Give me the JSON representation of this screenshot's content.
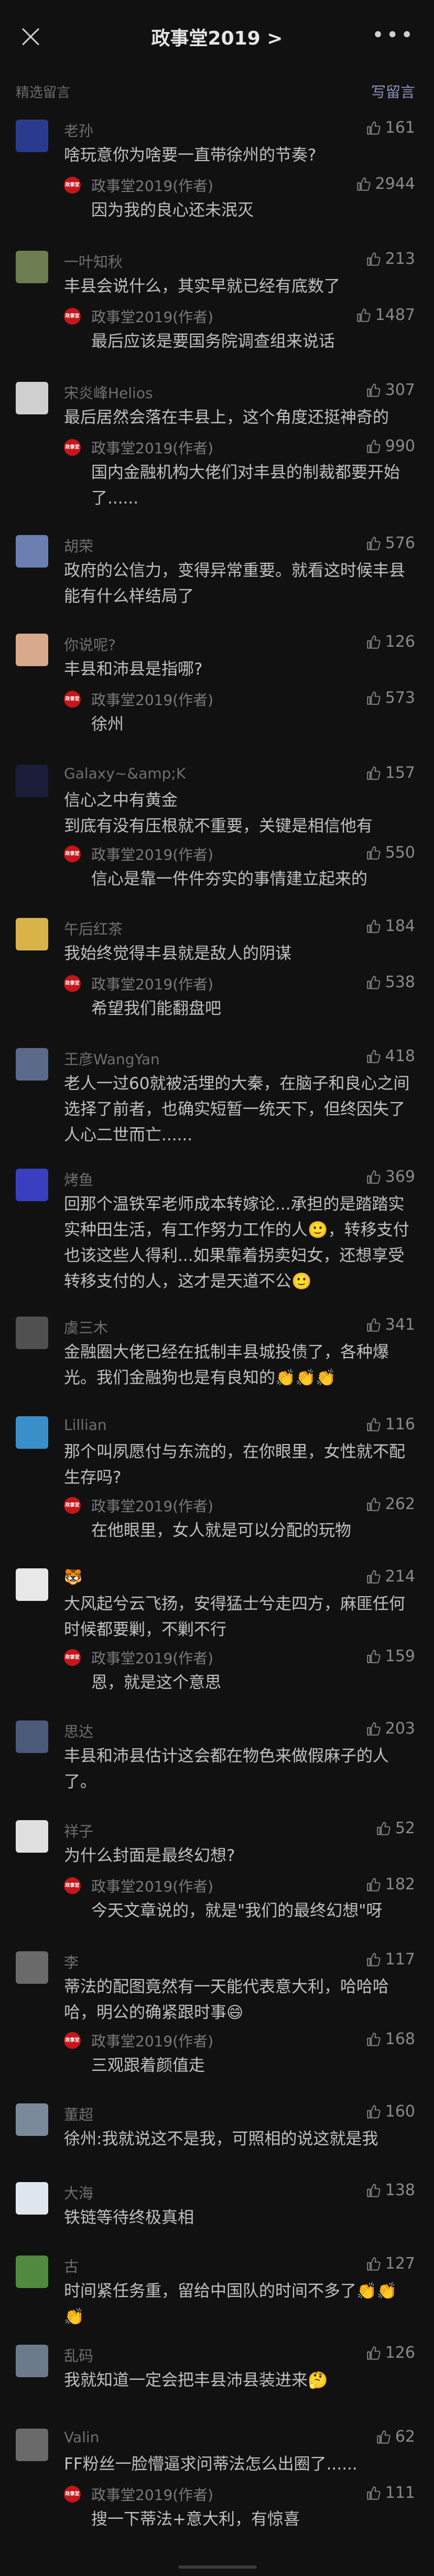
{
  "nav": {
    "title": "政事堂2019 >",
    "more": "•••"
  },
  "section": {
    "label": "精选留言",
    "write": "写留言"
  },
  "colors": {
    "bg": "#111111",
    "text": "#c0c0c0",
    "meta": "#6f6f6f",
    "link": "#8a93b8",
    "brand": "#c5161c"
  },
  "reply_author": "政事堂2019(作者)",
  "avatar_text": "政事堂",
  "comments": [
    {
      "user": "老孙",
      "likes": "161",
      "text": "啥玩意你为啥要一直带徐州的节奏?",
      "reply_likes": "2944",
      "reply": "因为我的良心还未泯灭",
      "avatar": "#2a3b8f"
    },
    {
      "user": "一叶知秋",
      "likes": "213",
      "text": "丰县会说什么，其实早就已经有底数了",
      "reply_likes": "1487",
      "reply": "最后应该是要国务院调查组来说话",
      "avatar": "#6d7d4f"
    },
    {
      "user": "宋炎峰Helios",
      "likes": "307",
      "text": "最后居然会落在丰县上，这个角度还挺神奇的",
      "reply_likes": "990",
      "reply": "国内金融机构大佬们对丰县的制裁都要开始了......",
      "avatar": "#d0d0d0"
    },
    {
      "user": "胡荣",
      "likes": "576",
      "text": "政府的公信力，变得异常重要。就看这时候丰县能有什么样结局了",
      "reply_likes": "",
      "reply": "",
      "avatar": "#6a7fb0"
    },
    {
      "user": "你说呢?",
      "likes": "126",
      "text": "丰县和沛县是指哪?",
      "reply_likes": "573",
      "reply": "徐州",
      "avatar": "#d8a98a"
    },
    {
      "user": "Galaxy~&amp;K",
      "likes": "157",
      "text": "信心之中有黄金\n到底有没有压根就不重要，关键是相信他有",
      "reply_likes": "550",
      "reply": "信心是靠一件件夯实的事情建立起来的",
      "avatar": "#1b1d3a"
    },
    {
      "user": "午后红茶",
      "likes": "184",
      "text": "我始终觉得丰县就是敌人的阴谋",
      "reply_likes": "538",
      "reply": "希望我们能翻盘吧",
      "avatar": "#d9b24a"
    },
    {
      "user": "王彦WangYan",
      "likes": "418",
      "text": "老人一过60就被活埋的大秦，在脑子和良心之间选择了前者，也确实短暂一统天下，但终因失了人心二世而亡......",
      "reply_likes": "",
      "reply": "",
      "avatar": "#5a6a8a"
    },
    {
      "user": "烤鱼",
      "likes": "369",
      "text": "回那个温铁军老师成本转嫁论...承担的是踏踏实实种田生活，有工作努力工作的人🙂，转移支付也该这些人得利...如果靠着拐卖妇女，还想享受转移支付的人，这才是天道不公🙂",
      "reply_likes": "",
      "reply": "",
      "avatar": "#3a3fbf"
    },
    {
      "user": "虞三木",
      "likes": "341",
      "text": "金融圈大佬已经在抵制丰县城投债了，各种爆光。我们金融狗也是有良知的👏👏👏",
      "reply_likes": "",
      "reply": "",
      "avatar": "#505050"
    },
    {
      "user": "Lillian",
      "likes": "116",
      "text": "那个叫夙愿付与东流的，在你眼里，女性就不配生存吗?",
      "reply_likes": "262",
      "reply": "在他眼里，女人就是可以分配的玩物",
      "avatar": "#3b8fc9"
    },
    {
      "user": "🐯",
      "likes": "214",
      "text": "大风起兮云飞扬，安得猛士兮走四方，麻匪任何时候都要剿，不剿不行",
      "reply_likes": "159",
      "reply": "恩，就是这个意思",
      "avatar": "#e8e8e8"
    },
    {
      "user": "思达",
      "likes": "203",
      "text": "丰县和沛县估计这会都在物色来做假麻子的人了。",
      "reply_likes": "",
      "reply": "",
      "avatar": "#4a5a7a"
    },
    {
      "user": "祥子",
      "likes": "52",
      "text": "为什么封面是最终幻想?",
      "reply_likes": "182",
      "reply": "今天文章说的，就是\"我们的最终幻想\"呀",
      "avatar": "#e0e0e0"
    },
    {
      "user": "李",
      "likes": "117",
      "text": "蒂法的配图竟然有一天能代表意大利，哈哈哈哈，明公的确紧跟时事😄",
      "reply_likes": "168",
      "reply": "三观跟着颜值走",
      "avatar": "#6a6a6a"
    },
    {
      "user": "董超",
      "likes": "160",
      "text": "徐州:我就说这不是我，可照相的说这就是我",
      "reply_likes": "",
      "reply": "",
      "avatar": "#7a8a9a"
    },
    {
      "user": "大海",
      "likes": "138",
      "text": "铁链等待终极真相",
      "reply_likes": "",
      "reply": "",
      "avatar": "#dfe6ef"
    },
    {
      "user": "古",
      "likes": "127",
      "text": "时间紧任务重，留给中国队的时间不多了👏👏👏",
      "reply_likes": "",
      "reply": "",
      "avatar": "#4f8a3f"
    },
    {
      "user": "乱码",
      "likes": "126",
      "text": "我就知道一定会把丰县沛县装进来🤔",
      "reply_likes": "",
      "reply": "",
      "avatar": "#6b7b8b"
    },
    {
      "user": "Valin",
      "likes": "62",
      "text": "FF粉丝一脸懵逼求问蒂法怎么出圈了......",
      "reply_likes": "111",
      "reply": "搜一下蒂法+意大利，有惊喜",
      "avatar": "#6a6a6a"
    }
  ]
}
